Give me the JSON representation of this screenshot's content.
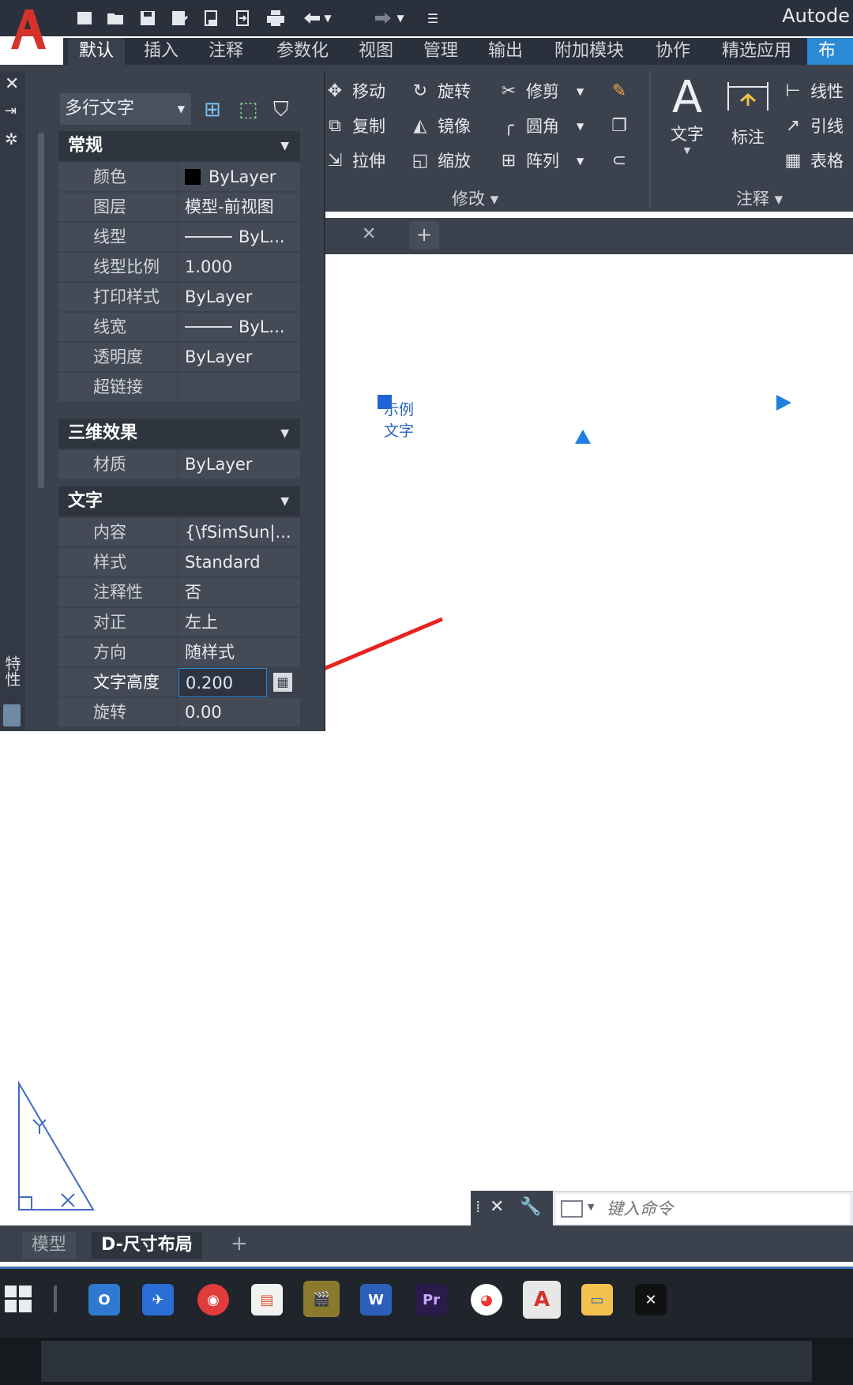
{
  "app": {
    "title": "Autode",
    "logo_letter": "A"
  },
  "quick_access": [
    "new-icon",
    "open-icon",
    "save-icon",
    "save-as-icon",
    "plot-icon",
    "upload-icon",
    "print-icon",
    "undo-icon",
    "redo-icon",
    "customize-icon"
  ],
  "ribbon_tabs": [
    "默认",
    "插入",
    "注释",
    "参数化",
    "视图",
    "管理",
    "输出",
    "附加模块",
    "协作",
    "精选应用",
    "布局"
  ],
  "ribbon": {
    "modify": {
      "items": [
        "移动",
        "旋转",
        "修剪",
        "复制",
        "镜像",
        "圆角",
        "拉伸",
        "缩放",
        "阵列"
      ],
      "title": "修改"
    },
    "annotation": {
      "text_label": "文字",
      "dim_label": "标注",
      "items": [
        "线性",
        "引线",
        "表格"
      ],
      "title": "注释"
    }
  },
  "palette": {
    "object_type": "多行文字",
    "sections": {
      "general": "常规",
      "threed": "三维效果",
      "text": "文字"
    },
    "general_rows": [
      {
        "label": "颜色",
        "value": "ByLayer"
      },
      {
        "label": "图层",
        "value": "模型-前视图"
      },
      {
        "label": "线型",
        "value": "ByL..."
      },
      {
        "label": "线型比例",
        "value": "1.000"
      },
      {
        "label": "打印样式",
        "value": "ByLayer"
      },
      {
        "label": "线宽",
        "value": "ByL..."
      },
      {
        "label": "透明度",
        "value": "ByLayer"
      },
      {
        "label": "超链接",
        "value": ""
      }
    ],
    "threed_rows": [
      {
        "label": "材质",
        "value": "ByLayer"
      }
    ],
    "text_rows": [
      {
        "label": "内容",
        "value": "{\\fSimSun|..."
      },
      {
        "label": "样式",
        "value": "Standard"
      },
      {
        "label": "注释性",
        "value": "否"
      },
      {
        "label": "对正",
        "value": "左上"
      },
      {
        "label": "方向",
        "value": "随样式"
      },
      {
        "label": "文字高度",
        "value": "0.200"
      },
      {
        "label": "旋转",
        "value": "0.00"
      }
    ],
    "vertical_label": "特性"
  },
  "drawing": {
    "sample_text_line1": "示例",
    "sample_text_line2": "文字"
  },
  "layout_tabs": {
    "model": "模型",
    "layout": "D-尺寸布局",
    "add": "+"
  },
  "command_line": {
    "placeholder": "键入命令"
  },
  "colors": {
    "accent": "#2a8ad6",
    "ribbon_bg": "#3b424e",
    "arrow": "#e8231f"
  }
}
